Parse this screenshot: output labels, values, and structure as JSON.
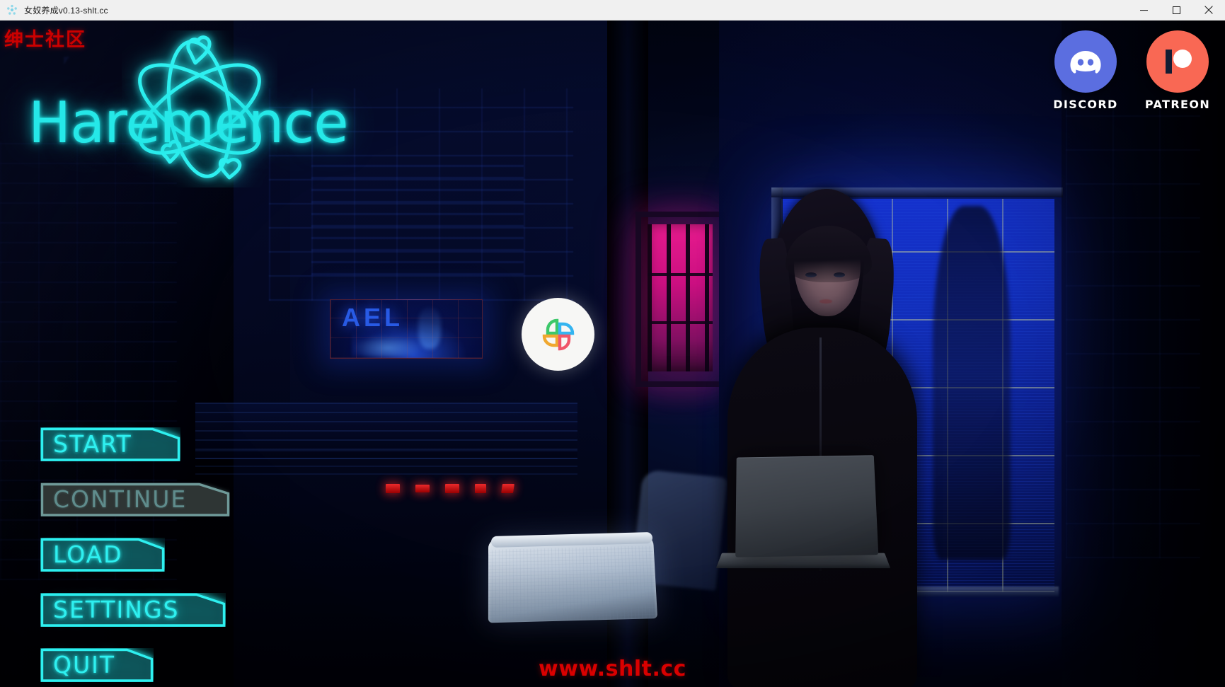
{
  "window": {
    "title": "女奴养成v0.13-shlt.cc",
    "icon": "app-icon",
    "controls": {
      "minimize": "minimize-icon",
      "maximize": "maximize-icon",
      "close": "close-icon"
    }
  },
  "overlay": {
    "community_tag": "绅士社区",
    "community_tag_color": "#cc0000",
    "site_watermark": "www.shlt.cc",
    "site_watermark_color": "#d90000",
    "watermark_logo": "four-petal-flower-icon",
    "watermark_colors": {
      "top_left": "#3dc86a",
      "top_right": "#34b4f0",
      "bottom_left": "#f0a830",
      "bottom_right": "#f0566a"
    }
  },
  "logo": {
    "wordmark": "Haremence",
    "accent_color": "#25e8e8",
    "emblem": "atom-hearts-icon"
  },
  "menu": {
    "items": [
      {
        "id": "start",
        "label": "START",
        "state": "enabled"
      },
      {
        "id": "continue",
        "label": "CONTINUE",
        "state": "disabled"
      },
      {
        "id": "load",
        "label": "LOAD",
        "state": "enabled"
      },
      {
        "id": "settings",
        "label": "SETTINGS",
        "state": "enabled"
      },
      {
        "id": "quit",
        "label": "QUIT",
        "state": "enabled"
      }
    ],
    "enabled_color": "#2ef0f0",
    "disabled_color": "#5f8c8c"
  },
  "socials": [
    {
      "id": "discord",
      "label": "DISCORD",
      "icon": "discord-icon",
      "color": "#5b6ee0"
    },
    {
      "id": "patreon",
      "label": "PATREON",
      "icon": "patreon-icon",
      "color": "#f96854"
    }
  ],
  "scene": {
    "hologram_text": "AEL",
    "hologram_color": "#2e68ff",
    "window_glow_color": "#1634d8",
    "barred_window_color": "#ff1e9b",
    "led_color": "#ff2d2d"
  }
}
